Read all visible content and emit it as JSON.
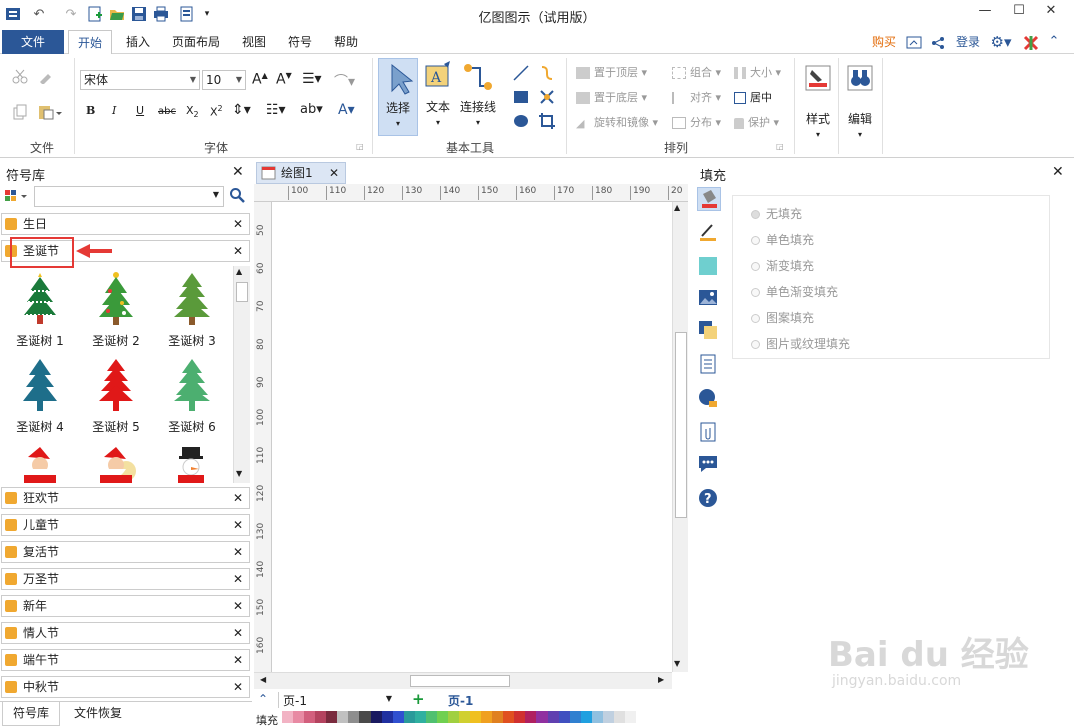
{
  "window": {
    "title": "亿图图示（试用版）",
    "minimize": "—",
    "maximize": "☐",
    "close": "✕"
  },
  "tabs": {
    "file": "文件",
    "home": "开始",
    "insert": "插入",
    "layout": "页面布局",
    "view": "视图",
    "symbol": "符号",
    "help": "帮助"
  },
  "right_links": {
    "buy": "购买",
    "login": "登录"
  },
  "ribbon": {
    "file_group": "文件",
    "font_group": "字体",
    "font_name": "宋体",
    "font_size": "10",
    "basic_tools_group": "基本工具",
    "select": "选择",
    "text": "文本",
    "connector": "连接线",
    "arrange_group": "排列",
    "bring_to_front": "置于顶层",
    "send_to_back": "置于底层",
    "rotate_mirror": "旋转和镜像",
    "group": "组合",
    "align": "对齐",
    "distribute": "分布",
    "size": "大小",
    "center": "居中",
    "protect": "保护",
    "style": "样式",
    "edit": "编辑"
  },
  "library": {
    "title": "符号库",
    "search_placeholder": "",
    "categories_top": [
      "生日",
      "圣诞节"
    ],
    "symbols": [
      "圣诞树 1",
      "圣诞树 2",
      "圣诞树 3",
      "圣诞树 4",
      "圣诞树 5",
      "圣诞树 6"
    ],
    "categories_bottom": [
      "狂欢节",
      "儿童节",
      "复活节",
      "万圣节",
      "新年",
      "情人节",
      "端午节",
      "中秋节"
    ],
    "bottom_tabs": [
      "符号库",
      "文件恢复"
    ]
  },
  "document": {
    "tab": "绘图1",
    "ruler_h": [
      "100",
      "110",
      "120",
      "130",
      "140",
      "150",
      "160",
      "170",
      "180",
      "190",
      "20"
    ],
    "ruler_v": [
      "50",
      "60",
      "70",
      "80",
      "90",
      "100",
      "110",
      "120",
      "130",
      "140",
      "150",
      "160"
    ],
    "page_select": "页-1",
    "page_tab": "页-1",
    "fill_label": "填充"
  },
  "fill_panel": {
    "title": "填充",
    "options": [
      "无填充",
      "单色填充",
      "渐变填充",
      "单色渐变填充",
      "图案填充",
      "图片或纹理填充"
    ]
  },
  "watermark": {
    "text": "Bai du 经验",
    "url": "jingyan.baidu.com"
  }
}
